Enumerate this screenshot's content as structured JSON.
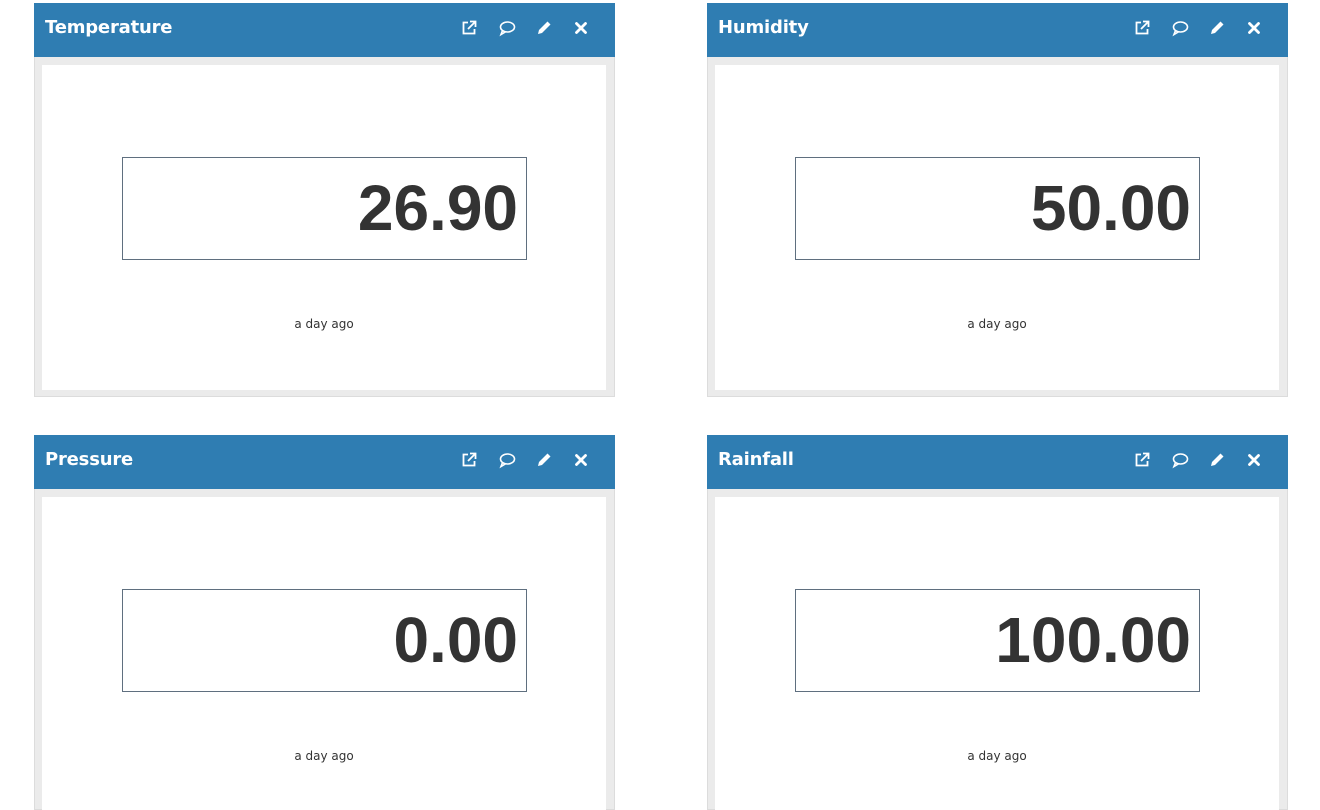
{
  "widgets": [
    {
      "title": "Temperature",
      "value": "26.90",
      "updated": "a day ago"
    },
    {
      "title": "Humidity",
      "value": "50.00",
      "updated": "a day ago"
    },
    {
      "title": "Pressure",
      "value": "0.00",
      "updated": "a day ago"
    },
    {
      "title": "Rainfall",
      "value": "100.00",
      "updated": "a day ago"
    }
  ],
  "icons": {
    "popout": "external-link-icon",
    "comment": "comment-icon",
    "edit": "pencil-icon",
    "close": "close-icon"
  },
  "colors": {
    "header": "#2f7db2",
    "header_text": "#ffffff",
    "value_text": "#333333",
    "panel_frame": "#ebebeb",
    "value_border": "#5f6f7f"
  }
}
